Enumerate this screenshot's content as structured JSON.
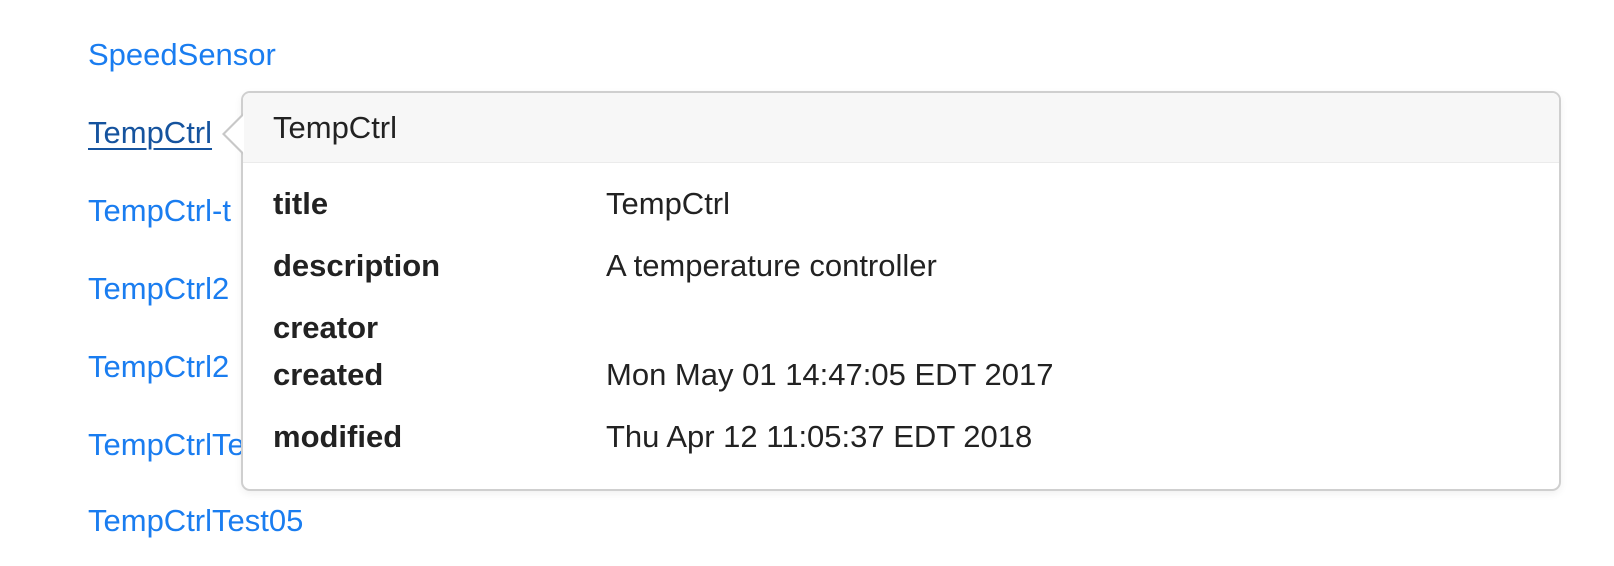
{
  "links": [
    "SpeedSensor",
    "TempCtrl",
    "TempCtrl-t",
    "TempCtrl2",
    "TempCtrl2",
    "TempCtrlTe",
    "TempCtrlTest05"
  ],
  "popover": {
    "title": "TempCtrl",
    "properties": [
      {
        "key": "title",
        "value": "TempCtrl"
      },
      {
        "key": "description",
        "value": "A temperature controller"
      },
      {
        "key": "creator",
        "value": ""
      },
      {
        "key": "created",
        "value": "Mon May 01 14:47:05 EDT 2017"
      },
      {
        "key": "modified",
        "value": "Thu Apr 12 11:05:37 EDT 2018"
      }
    ]
  },
  "colors": {
    "link": "#1a7df0",
    "link_active": "#15539e",
    "popover_header_bg": "#f7f7f7",
    "popover_border": "#cfcfcf"
  }
}
